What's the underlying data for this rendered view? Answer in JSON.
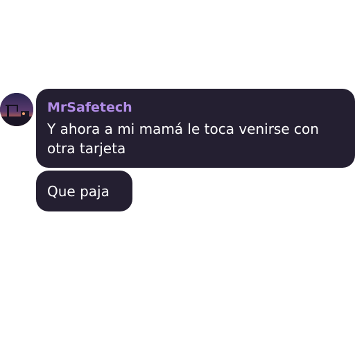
{
  "message_group": {
    "avatar_icon": "sunset-landscape-avatar",
    "sender_name": "MrSafetech",
    "sender_color": "#b18ce6",
    "bubble_color": "#241f31",
    "messages": [
      {
        "text": "Y ahora a mi mamá le toca venirse con otra tarjeta"
      },
      {
        "text": "Que paja"
      }
    ]
  }
}
